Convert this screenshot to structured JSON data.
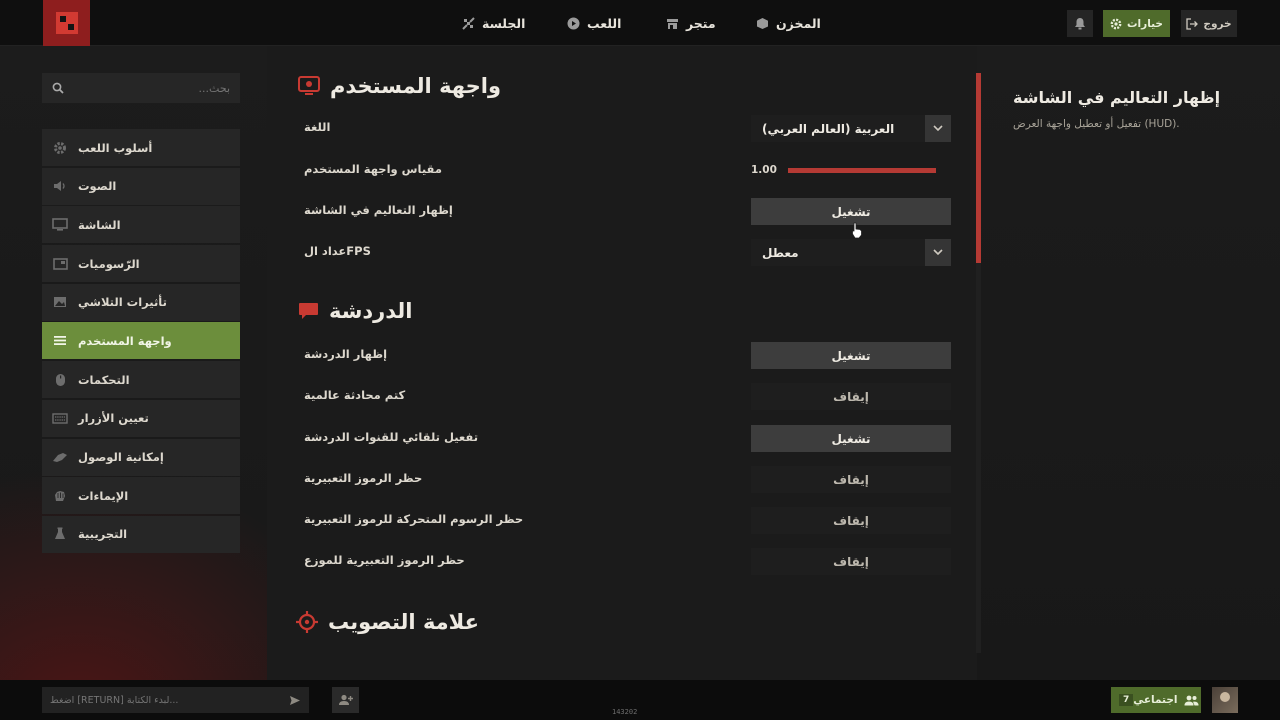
{
  "colors": {
    "accent_green": "#6c8e3c",
    "accent_red": "#b53a34",
    "logo_red": "#8e1e1e"
  },
  "top_nav": {
    "items": [
      {
        "label": "المخزن",
        "icon": "cube-icon"
      },
      {
        "label": "متجر",
        "icon": "store-icon"
      },
      {
        "label": "اللعب",
        "icon": "play-icon"
      },
      {
        "label": "الجلسة",
        "icon": "satellite-icon"
      }
    ],
    "options_label": "خيارات",
    "exit_label": "خروج"
  },
  "sidebar": {
    "search_placeholder": "بحث...",
    "items": [
      {
        "label": "أسلوب اللعب",
        "icon": "gear-icon"
      },
      {
        "label": "الصوت",
        "icon": "speaker-icon"
      },
      {
        "label": "الشاشة",
        "icon": "monitor-icon"
      },
      {
        "label": "الرّسوميات",
        "icon": "picture-icon"
      },
      {
        "label": "تأثيرات التلاشي",
        "icon": "image-icon"
      },
      {
        "label": "واجهة المستخدم",
        "icon": "menu-icon",
        "active": true
      },
      {
        "label": "التحكمات",
        "icon": "mouse-icon"
      },
      {
        "label": "تعيين الأزرار",
        "icon": "keyboard-icon"
      },
      {
        "label": "إمكانية الوصول",
        "icon": "accessibility-icon"
      },
      {
        "label": "الإيماءات",
        "icon": "hand-icon"
      },
      {
        "label": "التجريبية",
        "icon": "flask-icon"
      }
    ]
  },
  "sections": {
    "ui": {
      "title": "واجهة المستخدم",
      "icon": "monitor-icon",
      "language_label": "اللغة",
      "language_value": "العربية (العالم العربي)",
      "scale_label": "مقياس واجهة المستخدم",
      "scale_value": "1.00",
      "scale_fraction": 1.0,
      "tutorials_label": "إظهار التعاليم في الشاشة",
      "tutorials_value": "تشغيل",
      "fps_label": "عداد الFPS",
      "fps_value": "معطل"
    },
    "chat": {
      "title": "الدردشة",
      "icon": "chat-bubble-icon",
      "rows": [
        {
          "label": "إظهار الدردشة",
          "value": "تشغيل",
          "state": "on"
        },
        {
          "label": "كتم محادثة عالمية",
          "value": "إيقاف",
          "state": "off"
        },
        {
          "label": "تفعيل تلقائي للقنوات الدردشة",
          "value": "تشغيل",
          "state": "on"
        },
        {
          "label": "حظر الرموز التعبيرية",
          "value": "إيقاف",
          "state": "off"
        },
        {
          "label": "حظر الرسوم المتحركة للرموز التعبيرية",
          "value": "إيقاف",
          "state": "off"
        },
        {
          "label": "حظر الرموز التعبيرية للموزع",
          "value": "إيقاف",
          "state": "off"
        }
      ]
    },
    "crosshair": {
      "title": "علامة التصويب",
      "icon": "crosshair-icon"
    }
  },
  "info_panel": {
    "title": "إظهار التعاليم في الشاشة",
    "description": "تفعيل أو تعطيل واجهة العرض (HUD)."
  },
  "bottom_bar": {
    "chat_placeholder": "اضغط [RETURN] لبدء الكتابة...",
    "build": "143202",
    "social_label": "اجتماعي",
    "social_count": "7"
  }
}
